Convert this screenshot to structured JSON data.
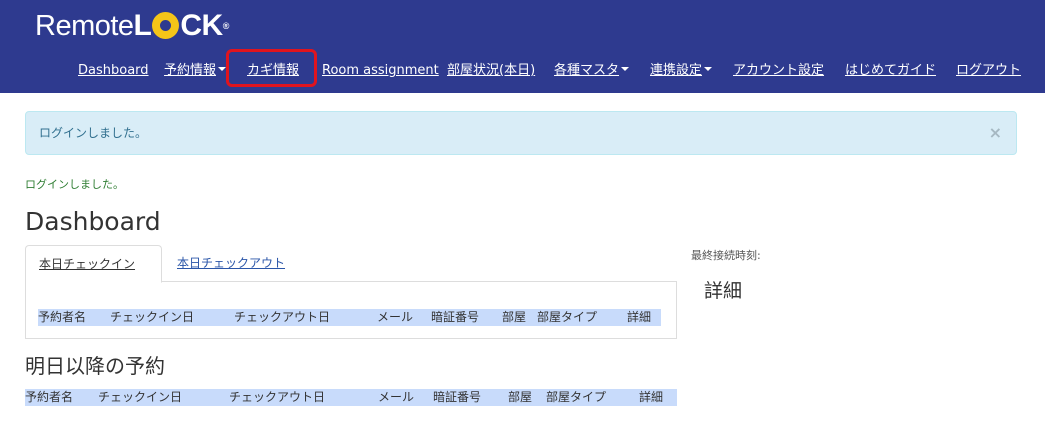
{
  "logo": {
    "remote": "Remote",
    "lock_l": "L",
    "lock_ck": "CK",
    "tm": "®"
  },
  "nav": {
    "items": [
      {
        "label": "Dashboard"
      },
      {
        "label": "予約情報"
      },
      {
        "label": "カギ情報"
      },
      {
        "label": "Room assignment"
      },
      {
        "label": "部屋状況(本日)"
      },
      {
        "label": "各種マスタ"
      },
      {
        "label": "連携設定"
      },
      {
        "label": "アカウント設定"
      },
      {
        "label": "はじめてガイド"
      },
      {
        "label": "ログアウト"
      }
    ],
    "highlight_color": "#e0141e",
    "background": "#2e3a8f"
  },
  "alert": {
    "message": "ログインしました。",
    "close": "×"
  },
  "flash": {
    "message": "ログインしました。"
  },
  "page": {
    "title": "Dashboard"
  },
  "tabs": [
    {
      "label": "本日チェックイン"
    },
    {
      "label": "本日チェックアウト"
    }
  ],
  "checkin_table": {
    "columns": [
      "予約者名",
      "チェックイン日",
      "チェックアウト日",
      "メール",
      "暗証番号",
      "部屋",
      "部屋タイプ",
      "詳細"
    ]
  },
  "upcoming": {
    "title": "明日以降の予約",
    "columns": [
      "予約者名",
      "チェックイン日",
      "チェックアウト日",
      "メール",
      "暗証番号",
      "部屋",
      "部屋タイプ",
      "詳細"
    ]
  },
  "sidebar": {
    "last_connection_label": "最終接続時刻:",
    "details_title": "詳細"
  }
}
